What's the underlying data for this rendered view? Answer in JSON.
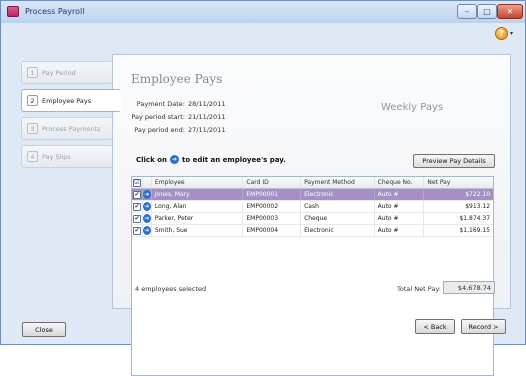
{
  "window": {
    "title": "Process Payroll",
    "controls": {
      "minimize": "–",
      "maximize": "□",
      "close": "✕"
    },
    "help_glyph": "?",
    "help_caret": "▾"
  },
  "sidebar": {
    "items": [
      {
        "num": "1",
        "label": "Pay Period",
        "active": false
      },
      {
        "num": "2",
        "label": "Employee Pays",
        "active": true
      },
      {
        "num": "3",
        "label": "Process Payments",
        "active": false
      },
      {
        "num": "4",
        "label": "Pay Slips",
        "active": false
      }
    ]
  },
  "panel": {
    "title": "Employee Pays",
    "payment_date_label": "Payment Date:",
    "payment_date": "28/11/2011",
    "period_start_label": "Pay period start:",
    "period_start": "21/11/2011",
    "period_end_label": "Pay period end:",
    "period_end": "27/11/2011",
    "frequency": "Weekly Pays",
    "instruction_prefix": "Click on",
    "instruction_suffix": "to edit an employee's pay.",
    "preview_button": "Preview Pay Details"
  },
  "table": {
    "headers": {
      "check": "☑",
      "employee": "Employee",
      "card_id": "Card ID",
      "payment_method": "Payment Method",
      "cheque_no": "Cheque No.",
      "net_pay": "Net Pay"
    },
    "rows": [
      {
        "checked": "✔",
        "employee": "Jones, Mary",
        "card_id": "EMP00001",
        "payment_method": "Electronic",
        "cheque_no": "Auto #",
        "net_pay": "$722.10"
      },
      {
        "checked": "✔",
        "employee": "Long, Alan",
        "card_id": "EMP00002",
        "payment_method": "Cash",
        "cheque_no": "Auto #",
        "net_pay": "$913.12"
      },
      {
        "checked": "✔",
        "employee": "Parker, Peter",
        "card_id": "EMP00003",
        "payment_method": "Cheque",
        "cheque_no": "Auto #",
        "net_pay": "$1,874.37"
      },
      {
        "checked": "✔",
        "employee": "Smith, Sue",
        "card_id": "EMP00004",
        "payment_method": "Electronic",
        "cheque_no": "Auto #",
        "net_pay": "$1,169.15"
      }
    ],
    "edit_glyph": "➔",
    "selected_row": 0
  },
  "footer": {
    "selected_count": "4 employees selected",
    "total_label": "Total Net Pay:",
    "total_value": "$4,678.74",
    "close_button": "Close",
    "back_button": "< Back",
    "record_button": "Record >"
  },
  "colors": {
    "selected_row": "#a58fc4",
    "edit_icon": "#2c6fd0",
    "window_bg": "#dfe9f5"
  }
}
